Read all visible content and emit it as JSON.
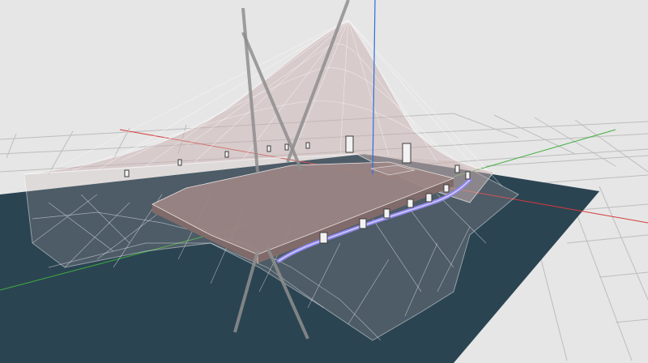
{
  "viewport": {
    "background": "#e6e6e6",
    "ground_grid_color": "#bdbdbd",
    "ground_plane_color": "#2b4452",
    "membrane_fill": "#c9b0b0",
    "membrane_mesh_color": "#ffffff",
    "deck_fill": "#9c8584",
    "axis_colors": {
      "x": "#d63b3b",
      "y": "#3fae3f",
      "z": "#2f6de0"
    },
    "cable_highlight_color": "#8f86e8",
    "mast_color": "#8e8e8e",
    "node_marker_color": "#3c3c3c"
  }
}
